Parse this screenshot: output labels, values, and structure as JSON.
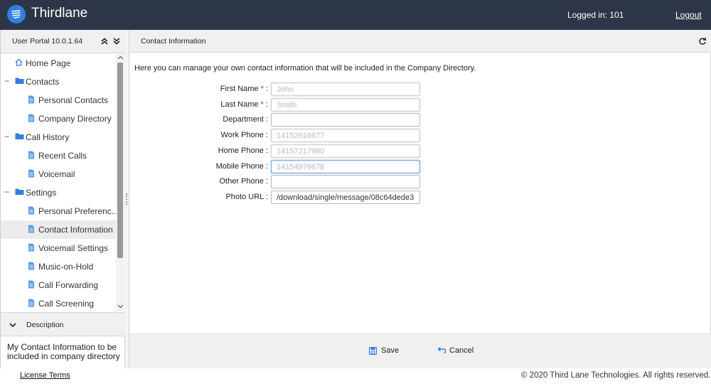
{
  "header": {
    "brand": "Thirdlane",
    "logged_in": "Logged in: 101",
    "logout_label": "Logout",
    "brand_color": "#2c3647",
    "logo_color": "#2f7fe0"
  },
  "sidebar": {
    "title": "User Portal 10.0.1.64",
    "collapse_all_icon": "double-chevron-up-icon",
    "expand_all_icon": "double-chevron-down-icon",
    "items": [
      {
        "label": "Home Page",
        "icon": "home-icon",
        "level": 0
      },
      {
        "label": "Contacts",
        "icon": "folder-icon",
        "level": 0,
        "expanded": true
      },
      {
        "label": "Personal Contacts",
        "icon": "document-icon",
        "level": 1
      },
      {
        "label": "Company Directory",
        "icon": "document-icon",
        "level": 1
      },
      {
        "label": "Call History",
        "icon": "folder-icon",
        "level": 0,
        "expanded": true
      },
      {
        "label": "Recent Calls",
        "icon": "document-icon",
        "level": 1
      },
      {
        "label": "Voicemail",
        "icon": "document-icon",
        "level": 1
      },
      {
        "label": "Settings",
        "icon": "folder-icon",
        "level": 0,
        "expanded": true
      },
      {
        "label": "Personal Preferenc...",
        "icon": "document-icon",
        "level": 1
      },
      {
        "label": "Contact Information",
        "icon": "document-icon",
        "level": 1,
        "selected": true
      },
      {
        "label": "Voicemail Settings",
        "icon": "document-icon",
        "level": 1
      },
      {
        "label": "Music-on-Hold",
        "icon": "document-icon",
        "level": 1
      },
      {
        "label": "Call Forwarding",
        "icon": "document-icon",
        "level": 1
      },
      {
        "label": "Call Screening",
        "icon": "document-icon",
        "level": 1
      }
    ]
  },
  "description": {
    "title": "Description",
    "text": "My Contact Information to be included in company directory"
  },
  "main": {
    "title": "Contact Information",
    "intro": "Here you can manage your own contact information that will be included in the Company Directory.",
    "fields": [
      {
        "label": "First Name",
        "required": true,
        "value": "John",
        "blurred": true
      },
      {
        "label": "Last Name",
        "required": true,
        "value": "Smith",
        "blurred": true
      },
      {
        "label": "Department",
        "required": false,
        "value": "",
        "blurred": false
      },
      {
        "label": "Work Phone",
        "required": false,
        "value": "14152616677",
        "blurred": true
      },
      {
        "label": "Home Phone",
        "required": false,
        "value": "14157217990",
        "blurred": true
      },
      {
        "label": "Mobile Phone",
        "required": false,
        "value": "14154976678",
        "blurred": true,
        "focused": true
      },
      {
        "label": "Other Phone",
        "required": false,
        "value": "",
        "blurred": false
      },
      {
        "label": "Photo URL",
        "required": false,
        "value": "/download/single/message/08c64dede3",
        "blurred": false
      }
    ],
    "save_label": "Save",
    "cancel_label": "Cancel"
  },
  "footer": {
    "license": "License Terms",
    "copyright": "© 2020 Third Lane Technologies. All rights reserved."
  }
}
